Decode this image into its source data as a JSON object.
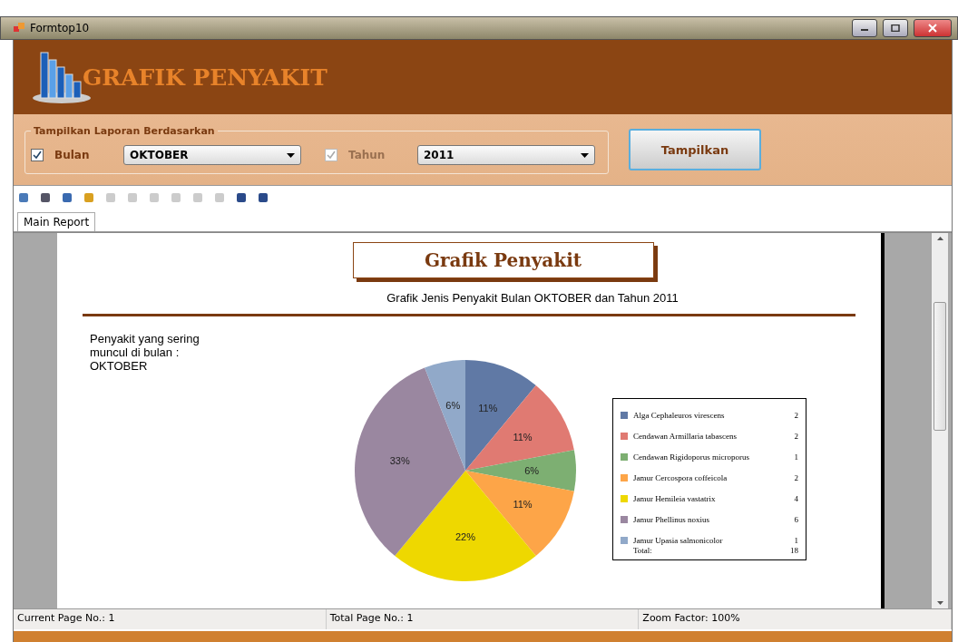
{
  "window": {
    "title": "Formtop10"
  },
  "banner": {
    "title": "GRAFIK PENYAKIT"
  },
  "filter": {
    "group_label": "Tampilkan Laporan Berdasarkan",
    "month": {
      "label": "Bulan",
      "checked": true,
      "disabled": false,
      "value": "OKTOBER"
    },
    "year": {
      "label": "Tahun",
      "checked": true,
      "disabled": true,
      "value": "2011"
    },
    "button": "Tampilkan"
  },
  "viewer": {
    "tabs": [
      {
        "label": "Main Report",
        "selected": true
      }
    ],
    "report": {
      "title": "Grafik Penyakit",
      "subtitle": "Grafik Jenis Penyakit Bulan OKTOBER dan Tahun 2011",
      "note": "Penyakit yang sering muncul di bulan : OKTOBER",
      "chart_data": {
        "type": "pie",
        "categories": [
          "Alga Cephaleuros virescens",
          "Cendawan Armillaria tabascens",
          "Cendawan Rigidoporus microporus",
          "Jamur Cercospora coffeicola",
          "Jamur Hemileia vastatrix",
          "Jamur Phellinus noxius",
          "Jamur Upasia salmonicolor"
        ],
        "values": [
          11,
          11,
          6,
          11,
          22,
          33,
          6
        ],
        "data_labels": true,
        "value_labels": [
          "11%",
          "11%",
          "6%",
          "11%",
          "22%",
          "33%",
          "6%"
        ]
      },
      "legend": {
        "items": [
          {
            "count": "2",
            "color": "#6079a5"
          },
          {
            "count": "2",
            "color": "#e07a72"
          },
          {
            "count": "1",
            "color": "#7daf72"
          },
          {
            "count": "2",
            "color": "#fda548"
          },
          {
            "count": "4",
            "color": "#eed800"
          },
          {
            "count": "6",
            "color": "#9a87a0"
          },
          {
            "count": "1",
            "color": "#91a9c9"
          }
        ],
        "total_label": "Total:",
        "total": "18"
      }
    },
    "status_bar": [
      "Current Page No.: 1",
      "Total Page No.: 1",
      "Zoom Factor: 100%"
    ]
  }
}
